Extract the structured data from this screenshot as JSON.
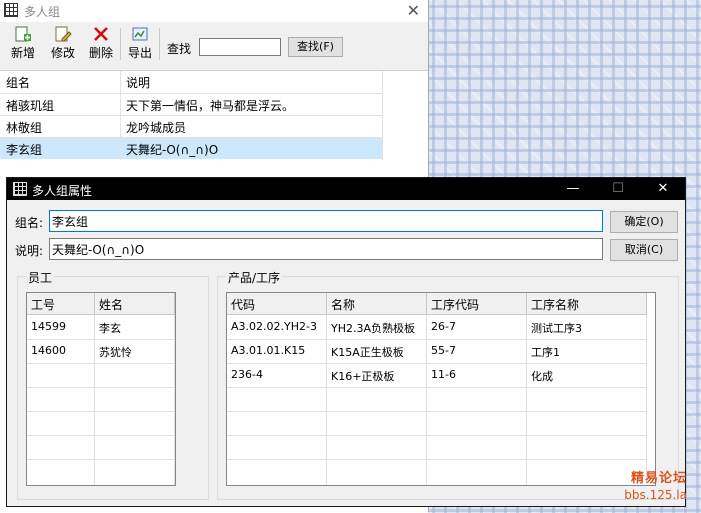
{
  "main_window": {
    "title": "多人组",
    "close_glyph": "✕",
    "toolbar": {
      "new_label": "新增",
      "edit_label": "修改",
      "delete_label": "删除",
      "export_label": "导出",
      "search_label": "查找",
      "search_value": "",
      "search_button_label": "查找(F)"
    },
    "grid": {
      "headers": [
        "组名",
        "说明"
      ],
      "rows": [
        {
          "name": "褚骇玑组",
          "desc": "天下第一情侣，神马都是浮云。"
        },
        {
          "name": "林敬组",
          "desc": "龙吟城成员"
        },
        {
          "name": "李玄组",
          "desc": "天舞纪-O(∩_∩)O",
          "selected": true
        }
      ]
    }
  },
  "dialog": {
    "title": "多人组属性",
    "controls": {
      "minimize": "—",
      "maximize": "☐",
      "close": "✕"
    },
    "group_name_label": "组名:",
    "group_name_value": "李玄组",
    "desc_label": "说明:",
    "desc_value": "天舞纪-O(∩_∩)O",
    "ok_label": "确定(O)",
    "cancel_label": "取消(C)",
    "employees": {
      "group_label": "员工",
      "headers": [
        "工号",
        "姓名"
      ],
      "rows": [
        {
          "id": "14599",
          "name": "李玄"
        },
        {
          "id": "14600",
          "name": "苏犹怜"
        }
      ]
    },
    "products": {
      "group_label": "产品/工序",
      "headers": [
        "代码",
        "名称",
        "工序代码",
        "工序名称"
      ],
      "rows": [
        {
          "code": "A3.02.02.YH2-3",
          "name": "YH2.3A负熟极板",
          "proc_code": "26-7",
          "proc_name": "测试工序3"
        },
        {
          "code": "A3.01.01.K15",
          "name": "K15A正生极板",
          "proc_code": "55-7",
          "proc_name": "工序1"
        },
        {
          "code": "236-4",
          "name": "K16+正极板",
          "proc_code": "11-6",
          "proc_name": "化成"
        }
      ]
    }
  },
  "watermark": {
    "line1": "精易论坛",
    "line2": "bbs.125.la"
  },
  "colors": {
    "selection": "#cce8ff",
    "focus_border": "#0078d7",
    "dialog_title_bg": "#000000",
    "watermark": "#d9531e"
  }
}
